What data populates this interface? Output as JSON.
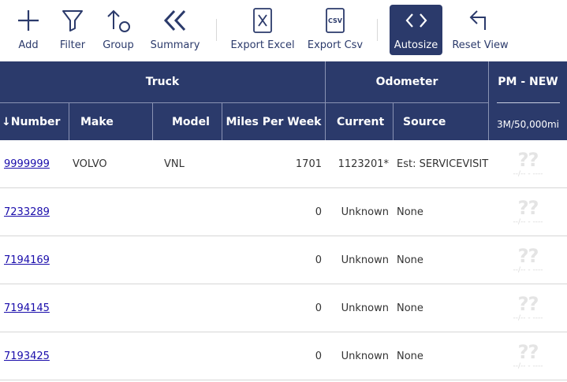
{
  "toolbar": {
    "add": "Add",
    "filter": "Filter",
    "group": "Group",
    "summary": "Summary",
    "export_excel": "Export Excel",
    "export_csv": "Export Csv",
    "csv_glyph": "CSV",
    "autosize": "Autosize",
    "reset_view": "Reset View",
    "active_color": "#2b3a6b"
  },
  "header": {
    "groups": {
      "truck": "Truck",
      "odometer": "Odometer",
      "pm": "PM - NEW"
    },
    "columns": {
      "number": "↓Number",
      "make": "Make",
      "model": "Model",
      "miles_per_week": "Miles Per Week",
      "current": "Current",
      "source": "Source",
      "pm_interval": "3M/50,000mi"
    },
    "bg_color": "#2b3a6b"
  },
  "rows": [
    {
      "number": "9999999",
      "make": "VOLVO",
      "model": "VNL",
      "miles_per_week": "1701",
      "current": "1123201*",
      "source": "Est: SERVICEVISIT",
      "pm": "??",
      "pm_sub": "--/-- - ----"
    },
    {
      "number": "7233289",
      "make": "",
      "model": "",
      "miles_per_week": "0",
      "current": "Unknown",
      "source": "None",
      "pm": "??",
      "pm_sub": "--/-- - ----"
    },
    {
      "number": "7194169",
      "make": "",
      "model": "",
      "miles_per_week": "0",
      "current": "Unknown",
      "source": "None",
      "pm": "??",
      "pm_sub": "--/-- - ----"
    },
    {
      "number": "7194145",
      "make": "",
      "model": "",
      "miles_per_week": "0",
      "current": "Unknown",
      "source": "None",
      "pm": "??",
      "pm_sub": "--/-- - ----"
    },
    {
      "number": "7193425",
      "make": "",
      "model": "",
      "miles_per_week": "0",
      "current": "Unknown",
      "source": "None",
      "pm": "??",
      "pm_sub": "--/-- - ----"
    }
  ]
}
